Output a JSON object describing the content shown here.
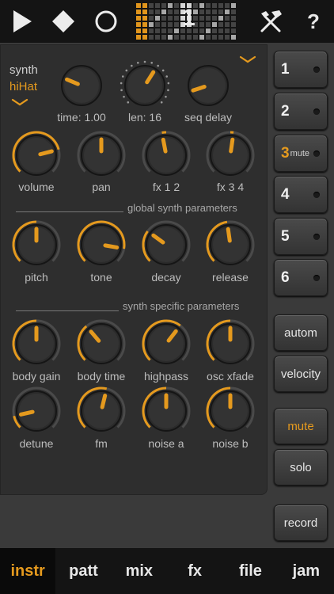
{
  "topbar": {
    "seq_number": "1",
    "help_label": "?"
  },
  "synth": {
    "label": "synth",
    "name": "hiHat"
  },
  "top_knobs": [
    {
      "label": "time: 1.00",
      "value": 0.25
    },
    {
      "label": "len: 16",
      "value": 0.62
    },
    {
      "label": "seq delay",
      "value": 0.1
    }
  ],
  "row_knobs": [
    {
      "label": "volume",
      "value": 0.78
    },
    {
      "label": "pan",
      "value": 0.5
    },
    {
      "label": "fx 1 2",
      "value": 0.46
    },
    {
      "label": "fx 3 4",
      "value": 0.53
    }
  ],
  "global_section": {
    "title": "global synth parameters"
  },
  "global_knobs": [
    {
      "label": "pitch",
      "value": 0.5
    },
    {
      "label": "tone",
      "value": 0.87
    },
    {
      "label": "decay",
      "value": 0.3
    },
    {
      "label": "release",
      "value": 0.47
    }
  ],
  "specific_section": {
    "title": "synth specific parameters"
  },
  "specific_knobs_1": [
    {
      "label": "body gain",
      "value": 0.5
    },
    {
      "label": "body time",
      "value": 0.35
    },
    {
      "label": "highpass",
      "value": 0.64
    },
    {
      "label": "osc xfade",
      "value": 0.5
    }
  ],
  "specific_knobs_2": [
    {
      "label": "detune",
      "value": 0.12
    },
    {
      "label": "fm",
      "value": 0.55
    },
    {
      "label": "noise a",
      "value": 0.5
    },
    {
      "label": "noise b",
      "value": 0.5
    }
  ],
  "tracks": [
    {
      "num": "1",
      "active": false,
      "mute": ""
    },
    {
      "num": "2",
      "active": false,
      "mute": ""
    },
    {
      "num": "3",
      "active": true,
      "mute": "mute"
    },
    {
      "num": "4",
      "active": false,
      "mute": ""
    },
    {
      "num": "5",
      "active": false,
      "mute": ""
    },
    {
      "num": "6",
      "active": false,
      "mute": ""
    }
  ],
  "side_buttons": {
    "autom": "autom",
    "velocity": "velocity",
    "mute": "mute",
    "solo": "solo",
    "record": "record"
  },
  "tabs": [
    {
      "label": "instr",
      "active": true
    },
    {
      "label": "patt",
      "active": false
    },
    {
      "label": "mix",
      "active": false
    },
    {
      "label": "fx",
      "active": false
    },
    {
      "label": "file",
      "active": false
    },
    {
      "label": "jam",
      "active": false
    }
  ],
  "colors": {
    "accent": "#e59a1e",
    "panel": "#2e2e2e",
    "bar": "#141414"
  }
}
